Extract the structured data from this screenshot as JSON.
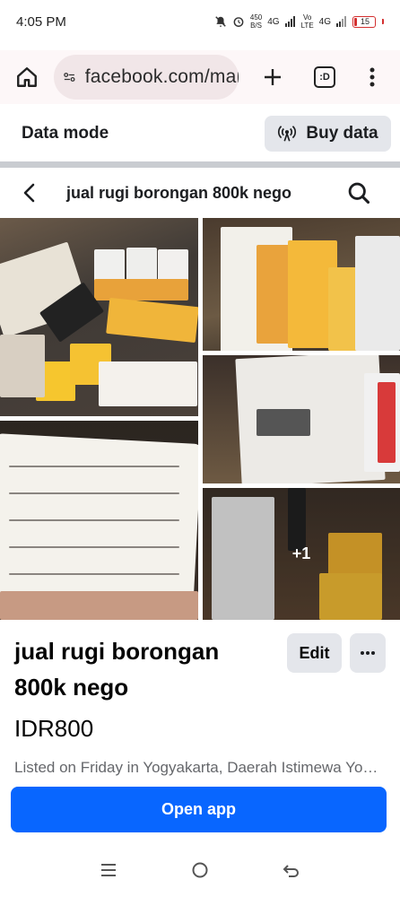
{
  "status_bar": {
    "time": "4:05 PM",
    "net_speed_value": "450",
    "net_speed_unit": "B/S",
    "network_1": "4G",
    "network_2_top": "Vo",
    "network_2_bottom": "LTE",
    "network_3": "4G",
    "battery_level": "15"
  },
  "browser": {
    "url": "facebook.com/marketplace",
    "tab_label": ":D"
  },
  "data_mode": {
    "label": "Data mode",
    "buy_button_label": "Buy data"
  },
  "header": {
    "title": "jual rugi borongan 800k nego"
  },
  "photos": {
    "more_count": "+1"
  },
  "listing": {
    "title": "jual rugi borongan 800k nego",
    "price": "IDR800",
    "meta": "Listed on Friday in Yogyakarta, Daerah Istimewa Yogyakarta",
    "edit_label": "Edit"
  },
  "cta": {
    "open_app_label": "Open app"
  },
  "colors": {
    "accent": "#0866ff",
    "button_bg": "#e4e6eb",
    "battery_low": "#d32f2f"
  }
}
